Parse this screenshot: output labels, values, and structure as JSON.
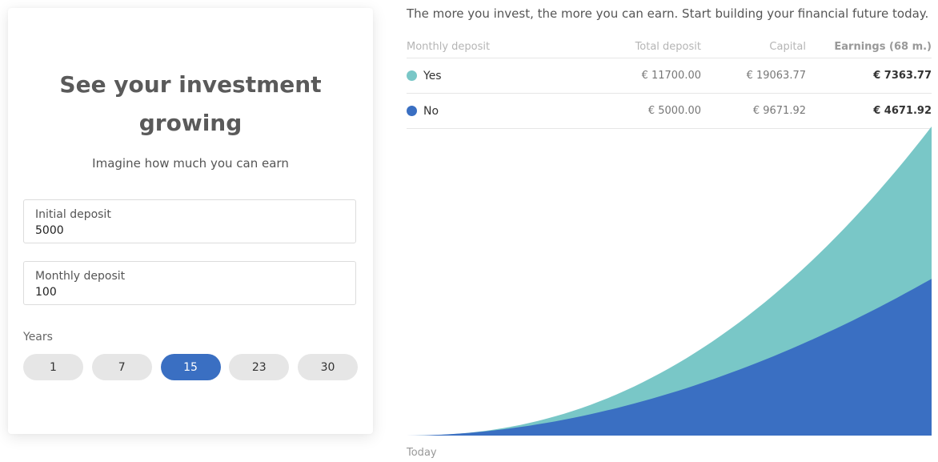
{
  "calculator": {
    "title_line1": "See your investment",
    "title_line2": "growing",
    "subtitle": "Imagine how much you can earn",
    "initial_deposit": {
      "label": "Initial deposit",
      "value": "5000"
    },
    "monthly_deposit": {
      "label": "Monthly deposit",
      "value": "100"
    },
    "years_label": "Years",
    "years_options": [
      "1",
      "7",
      "15",
      "23",
      "30"
    ],
    "years_selected": "15"
  },
  "results": {
    "intro": "The more you invest, the more you can earn. Start building your financial future today.",
    "headers": {
      "monthly_deposit": "Monthly deposit",
      "total_deposit": "Total deposit",
      "capital": "Capital",
      "earnings": "Earnings (68 m.)"
    },
    "rows": [
      {
        "label": "Yes",
        "color": "#79c7c7",
        "total_deposit": "€ 11700.00",
        "capital": "€ 19063.77",
        "earnings": "€ 7363.77"
      },
      {
        "label": "No",
        "color": "#3a6fc2",
        "total_deposit": "€ 5000.00",
        "capital": "€ 9671.92",
        "earnings": "€ 4671.92"
      }
    ],
    "chart_start_label": "Today"
  },
  "chart_data": {
    "type": "area",
    "series": [
      {
        "name": "Yes",
        "color": "#79c7c7",
        "end_value": 19063.77
      },
      {
        "name": "No",
        "color": "#3a6fc2",
        "end_value": 9671.92
      }
    ]
  }
}
